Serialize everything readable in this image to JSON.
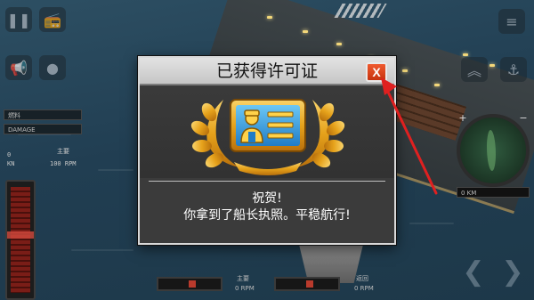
{
  "dialog": {
    "title": "已获得许可证",
    "close_label": "X",
    "message_line1": "祝贺!",
    "message_line2": "你拿到了船长执照。平稳航行!"
  },
  "hud": {
    "left_label_top": "燃料",
    "left_label_damage": "DAMAGE",
    "speed_value": "0",
    "speed_unit": "KN",
    "engine_label": "主要",
    "engine_rpm": "100 RPM",
    "radar_readout": "0 KM",
    "throttle_left_label": "主要",
    "throttle_left_rpm": "0 RPM",
    "throttle_right_label": "返回",
    "throttle_right_rpm": "0 RPM"
  },
  "colors": {
    "close_button": "#d9441a",
    "annotation_arrow": "#e02020",
    "badge_gold": "#e6a21b",
    "license_blue": "#2a8fd8"
  },
  "icons": {
    "badge": "license-badge-icon",
    "close": "close-icon",
    "arrow": "annotation-arrow-icon"
  }
}
